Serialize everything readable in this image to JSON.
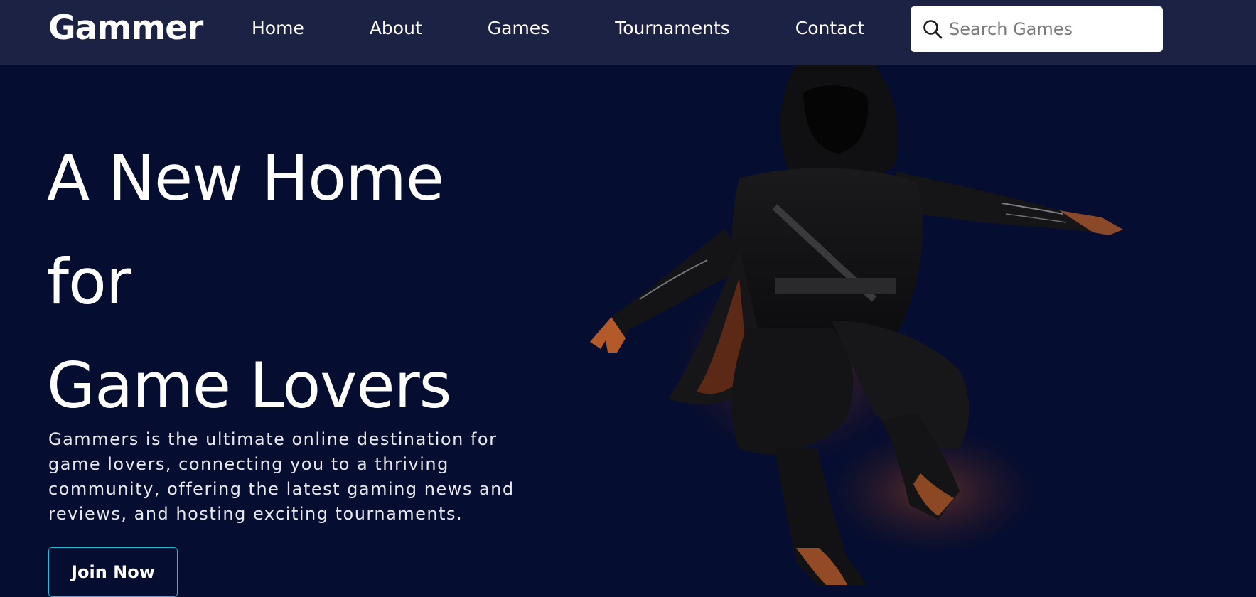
{
  "brand": {
    "logo": "Gammer"
  },
  "nav": {
    "items": [
      {
        "label": "Home"
      },
      {
        "label": "About"
      },
      {
        "label": "Games"
      },
      {
        "label": "Tournaments"
      },
      {
        "label": "Contact"
      }
    ]
  },
  "search": {
    "placeholder": "Search Games",
    "value": ""
  },
  "hero": {
    "title_lines": [
      "A New Home",
      "for",
      "Game Lovers"
    ],
    "description": "Gammers is the ultimate online destination for game lovers, connecting you to a thriving community, offering the latest gaming news and reviews, and hosting exciting tournaments.",
    "cta_label": "Join Now",
    "image_icon": "hooded-ninja-jumping-illustration"
  },
  "colors": {
    "background": "#050d30",
    "navbar": "#1c2244",
    "cta_border": "#22b8d6",
    "text": "#ffffff"
  }
}
